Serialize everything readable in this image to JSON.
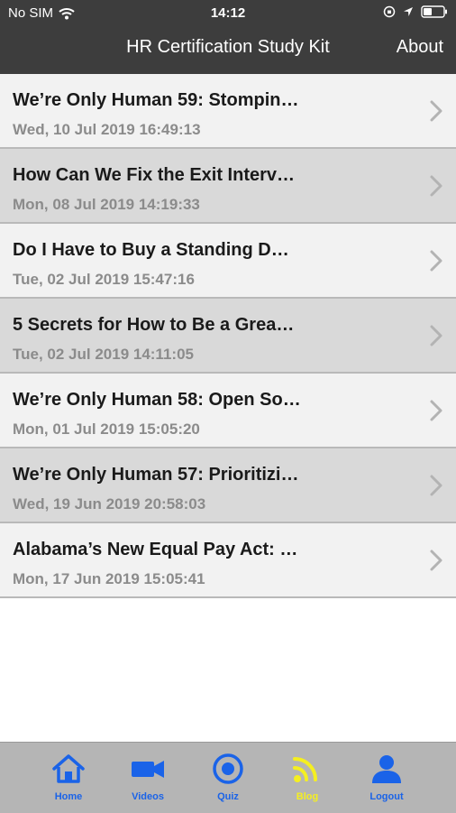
{
  "status_bar": {
    "carrier": "No SIM",
    "time": "14:12"
  },
  "nav": {
    "title": "HR Certification Study Kit",
    "about_label": "About"
  },
  "posts": [
    {
      "title": "We’re Only Human 59: Stompin…",
      "date": "Wed, 10 Jul 2019 16:49:13"
    },
    {
      "title": "How Can We Fix the Exit Interv…",
      "date": "Mon, 08 Jul 2019 14:19:33"
    },
    {
      "title": "Do I Have to Buy a Standing D…",
      "date": "Tue, 02 Jul 2019 15:47:16"
    },
    {
      "title": "5 Secrets for How to Be a Grea…",
      "date": "Tue, 02 Jul 2019 14:11:05"
    },
    {
      "title": "We’re Only Human 58: Open So…",
      "date": "Mon, 01 Jul 2019 15:05:20"
    },
    {
      "title": "We’re Only Human 57: Prioritizi…",
      "date": "Wed, 19 Jun 2019 20:58:03"
    },
    {
      "title": "Alabama’s New Equal Pay Act: …",
      "date": "Mon, 17 Jun 2019 15:05:41"
    }
  ],
  "tabs": [
    {
      "label": "Home",
      "icon": "home-icon"
    },
    {
      "label": "Videos",
      "icon": "video-camera-icon"
    },
    {
      "label": "Quiz",
      "icon": "target-icon"
    },
    {
      "label": "Blog",
      "icon": "rss-icon",
      "selected": true
    },
    {
      "label": "Logout",
      "icon": "person-icon"
    }
  ],
  "colors": {
    "header_bg": "#3d3d3d",
    "row_light": "#f2f2f2",
    "row_dark": "#d9d9d9",
    "tab_bar_bg": "#b5b5b5",
    "tab_active": "#f5ef21",
    "tab_inactive": "#1a63e8"
  }
}
